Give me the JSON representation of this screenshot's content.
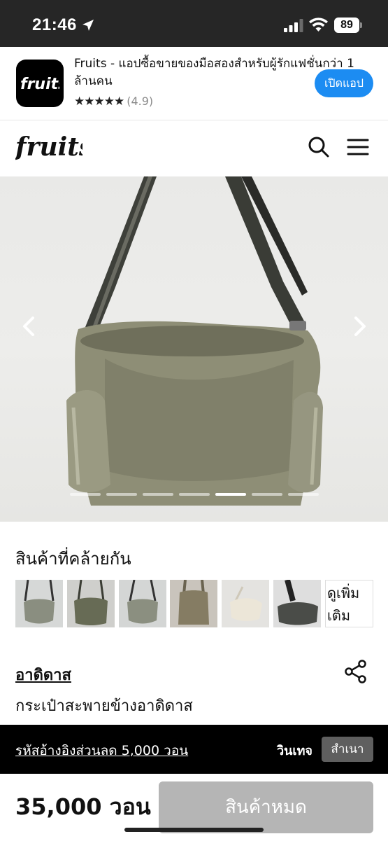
{
  "status_bar": {
    "time": "21:46",
    "battery": "89",
    "icons": [
      "location-arrow-icon",
      "signal-icon",
      "wifi-icon",
      "battery-icon"
    ]
  },
  "app_banner": {
    "title": "Fruits - แอปซื้อขายของมือสองสำหรับผู้รักแฟชั่นกว่า 1 ล้านคน",
    "stars": "★★★★★",
    "score": "(4.9)",
    "open_label": "เปิดแอป",
    "accent_color": "#1c8cf2"
  },
  "header": {
    "logo_text": "fruits",
    "icons": [
      "search-icon",
      "menu-icon"
    ]
  },
  "gallery": {
    "image_count": 7,
    "active_index": 4,
    "icons": [
      "chevron-left-icon",
      "chevron-right-icon"
    ]
  },
  "similar": {
    "title": "สินค้าที่คล้ายกัน",
    "see_more": "ดูเพิ่มเติม"
  },
  "product": {
    "brand": "อาดิดาส",
    "name": "กระเป๋าสะพายข้างอาดิดาส",
    "price": "35,000 วอน"
  },
  "coupon": {
    "text": "รหัสอ้างอิงส่วนลด 5,000 วอน",
    "code": "วินเทจ",
    "copy_label": "สำเนา"
  },
  "actions": {
    "sold_out_label": "สินค้าหมด"
  }
}
